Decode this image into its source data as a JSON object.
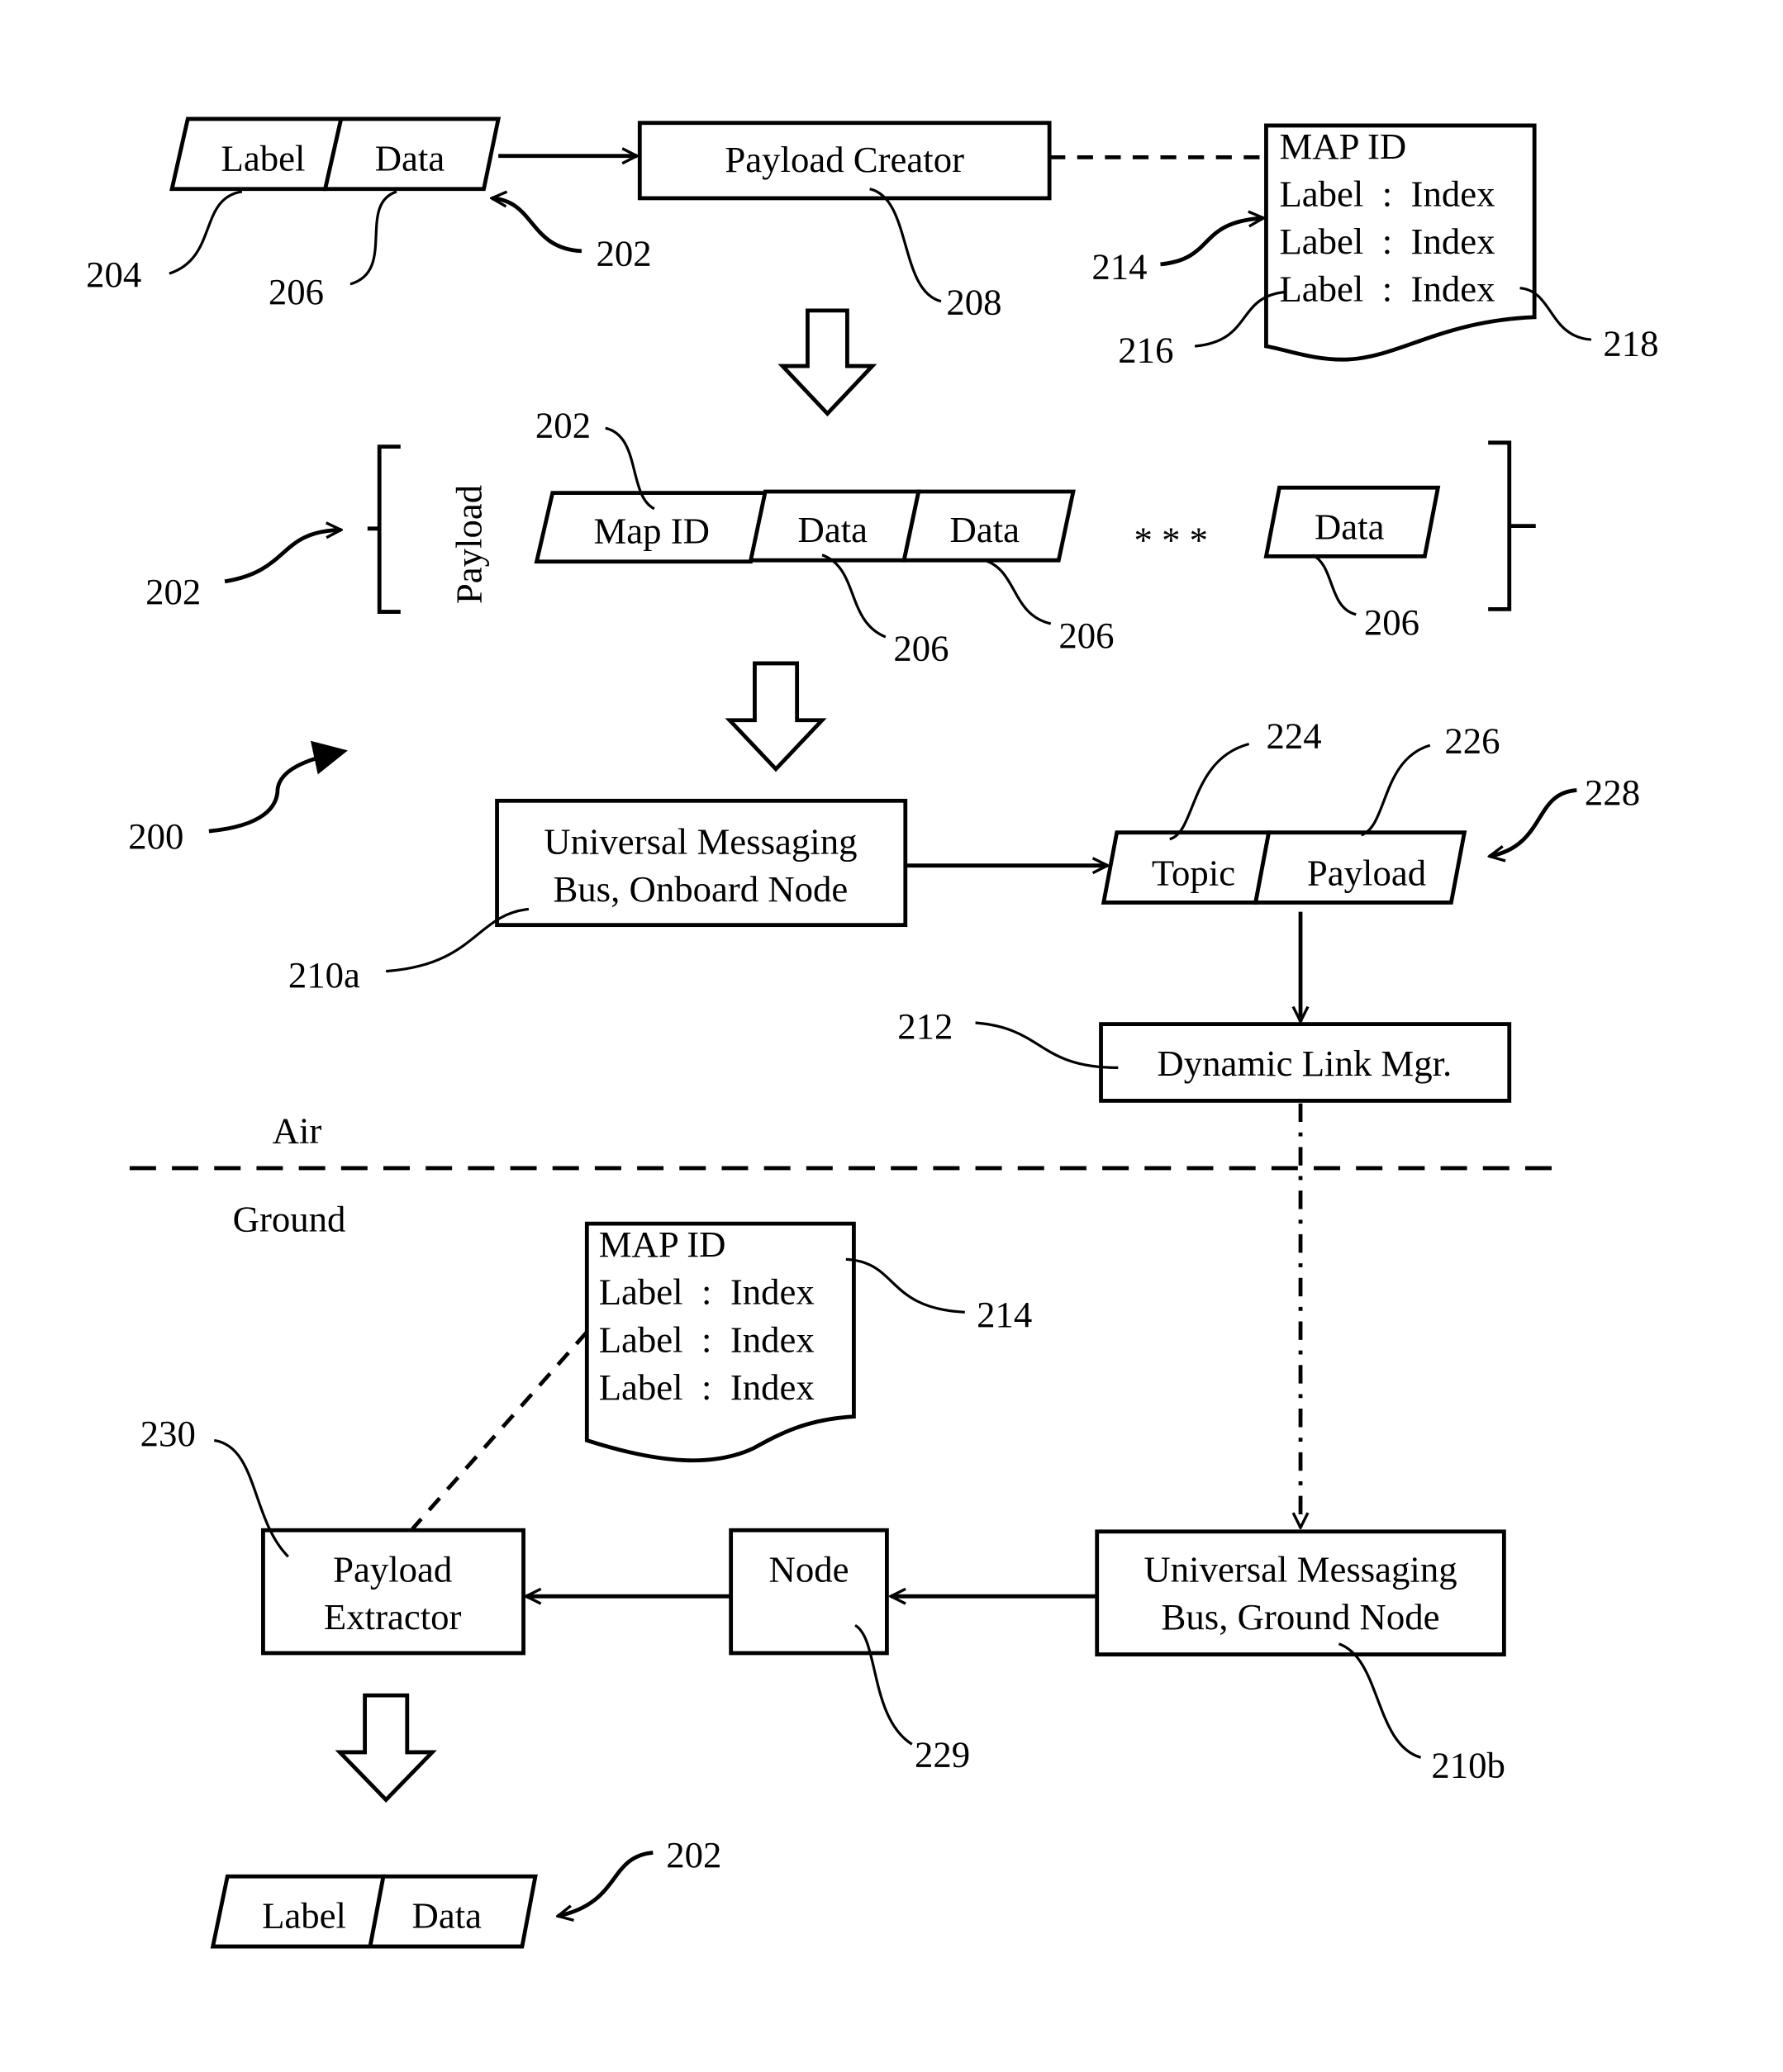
{
  "figure": {
    "ref_id": "200",
    "sections": {
      "air": "Air",
      "ground": "Ground"
    },
    "input_message": {
      "ref": "202",
      "label": "Label",
      "data": "Data",
      "label_ref": "204",
      "data_ref": "206"
    },
    "payload_creator": {
      "ref": "208",
      "label": "Payload Creator"
    },
    "map_top": {
      "ref": "214",
      "title": "MAP ID",
      "rows": [
        "Label  :  Index",
        "Label  :  Index",
        "Label  :  Index"
      ],
      "label_ref": "216",
      "index_ref": "218"
    },
    "payload": {
      "ref": "202",
      "bracket_label": "Payload",
      "map_id_ref": "202",
      "cells": [
        "Map ID",
        "Data",
        "Data",
        "Data"
      ],
      "ellipsis": "* * *",
      "data_refs": [
        "206",
        "206",
        "206"
      ]
    },
    "umb_onboard": {
      "ref": "210a",
      "line1": "Universal Messaging",
      "line2": "Bus, Onboard Node"
    },
    "message": {
      "ref": "228",
      "topic": "Topic",
      "payload": "Payload",
      "topic_ref": "224",
      "payload_ref": "226"
    },
    "dynamic_link": {
      "ref": "212",
      "label": "Dynamic Link Mgr."
    },
    "map_ground": {
      "ref": "214",
      "title": "MAP ID",
      "rows": [
        "Label  :  Index",
        "Label  :  Index",
        "Label  :  Index"
      ]
    },
    "payload_extractor": {
      "ref": "230",
      "line1": "Payload",
      "line2": "Extractor"
    },
    "node": {
      "ref": "229",
      "label": "Node"
    },
    "umb_ground": {
      "ref": "210b",
      "line1": "Universal Messaging",
      "line2": "Bus, Ground Node"
    },
    "output_message": {
      "ref": "202",
      "label": "Label",
      "data": "Data"
    }
  }
}
